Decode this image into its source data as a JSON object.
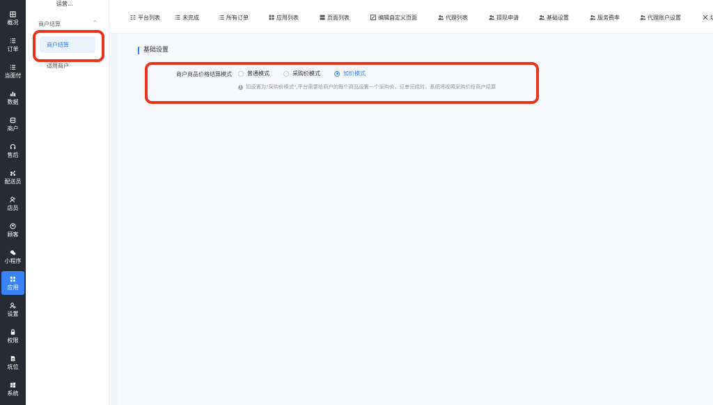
{
  "leftnav": {
    "items": [
      {
        "label": "概况",
        "icon": "dashboard-icon"
      },
      {
        "label": "订单",
        "icon": "list-icon"
      },
      {
        "label": "当面付",
        "icon": "list-icon"
      },
      {
        "label": "数据",
        "icon": "bar-chart-icon"
      },
      {
        "label": "商户",
        "icon": "store-icon"
      },
      {
        "label": "售后",
        "icon": "headset-icon"
      },
      {
        "label": "配送员",
        "icon": "scooter-icon"
      },
      {
        "label": "店员",
        "icon": "users-icon"
      },
      {
        "label": "顾客",
        "icon": "user-circle-icon"
      },
      {
        "label": "小程序",
        "icon": "wechat-icon"
      },
      {
        "label": "应用",
        "icon": "apps-icon"
      },
      {
        "label": "设置",
        "icon": "user-gear-icon"
      },
      {
        "label": "权限",
        "icon": "lock-icon"
      },
      {
        "label": "坑位",
        "icon": "document-icon"
      },
      {
        "label": "系统",
        "icon": "windows-icon"
      }
    ],
    "active_index": 10
  },
  "subnav": {
    "top_label": "运营...",
    "group_title": "商户结算",
    "group_caret": "^",
    "items": [
      {
        "label": "商户结算"
      },
      {
        "label": "适用商户"
      }
    ]
  },
  "tabs": [
    {
      "label": "平台列表",
      "icon": "list-settings-icon"
    },
    {
      "label": "未完成",
      "icon": "list-icon"
    },
    {
      "label": "所有订单",
      "icon": "list-icon"
    },
    {
      "label": "应用列表",
      "icon": "apps-icon"
    },
    {
      "label": "页面列表",
      "icon": "layout-icon"
    },
    {
      "label": "编辑自定义页面",
      "icon": "edit-icon"
    },
    {
      "label": "代理列表",
      "icon": "users-icon"
    },
    {
      "label": "提现申请",
      "icon": "users-icon"
    },
    {
      "label": "基础设置",
      "icon": "users-icon"
    },
    {
      "label": "服务费率",
      "icon": "users-icon"
    },
    {
      "label": "代理账户设置",
      "icon": "users-icon"
    },
    {
      "label": "坑",
      "icon": "tools-icon"
    }
  ],
  "main": {
    "section_title": "基础设置",
    "form_label": "商户商品价格结算模式",
    "radio_options": [
      "普通模式",
      "采购价模式",
      "加价模式"
    ],
    "selected_option": "加价模式",
    "hint_icon": "!",
    "hint_text": "如设置为\"采购价模式\",平台需要给商户的每个商品设置一个采购价，订单完成时，系统将按照采购价给商户结算"
  },
  "colors": {
    "nav_bg": "#272b33",
    "accent": "#3b82f6",
    "annotation": "#e8341c"
  }
}
